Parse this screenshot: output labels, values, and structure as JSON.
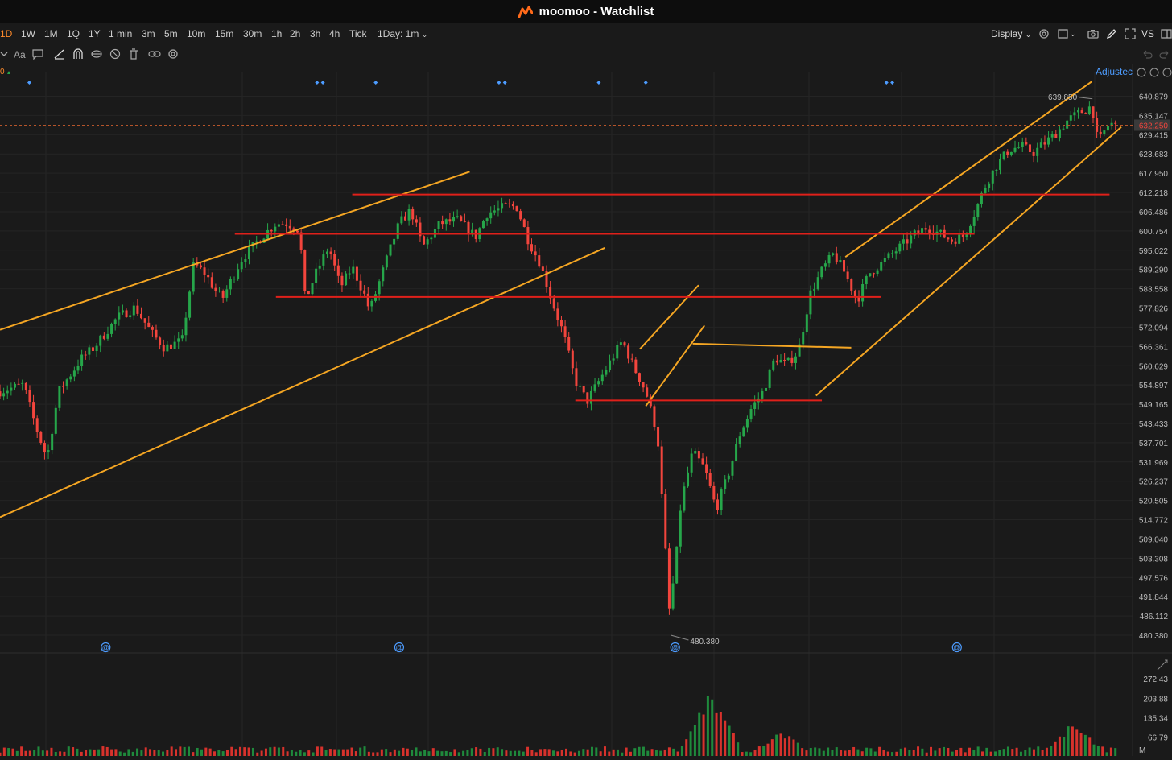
{
  "window": {
    "title": "moomoo - Watchlist"
  },
  "periods": [
    {
      "label": "1D",
      "active": true
    },
    {
      "label": "1W"
    },
    {
      "label": "1M"
    },
    {
      "label": "1Q"
    },
    {
      "label": "1Y"
    },
    {
      "label": "1 min"
    },
    {
      "label": "3m"
    },
    {
      "label": "5m"
    },
    {
      "label": "10m"
    },
    {
      "label": "15m"
    },
    {
      "label": "30m"
    },
    {
      "label": "1h"
    },
    {
      "label": "2h"
    },
    {
      "label": "3h"
    },
    {
      "label": "4h"
    },
    {
      "label": "Tick"
    }
  ],
  "period_dropdown": {
    "label": "1Day: 1m"
  },
  "controls": {
    "display_label": "Display",
    "vs_label": "VS",
    "adjusted_label": "Adjustec"
  },
  "tool_icons": [
    "chevron-down-icon",
    "font-icon",
    "comment-icon",
    "line-tool-icon",
    "magnet-icon",
    "eye-icon",
    "hide-icon",
    "trash-icon",
    "link-icon",
    "settings-icon"
  ],
  "colors": {
    "up": "#26a64a",
    "down": "#f2453d",
    "trendline": "#f5a623",
    "level": "#e0201a",
    "accent": "#ff8a2a",
    "background": "#1a1a1a"
  },
  "chart_data": {
    "type": "candlestick",
    "ylim": [
      477.5,
      646.0
    ],
    "yticks": [
      640.879,
      635.147,
      629.415,
      623.683,
      617.95,
      612.218,
      606.486,
      600.754,
      595.022,
      589.29,
      583.558,
      577.826,
      572.094,
      566.361,
      560.629,
      554.897,
      549.165,
      543.433,
      537.701,
      531.969,
      526.237,
      520.505,
      514.772,
      509.04,
      503.308,
      497.576,
      491.844,
      486.112,
      480.38
    ],
    "last_price": "632.250",
    "high_label": "639.850",
    "low_label": "480.380",
    "indicator_label": "0",
    "close_path": [
      [
        0,
        553
      ],
      [
        0.04,
        555
      ],
      [
        0.06,
        543
      ],
      [
        0.08,
        533
      ],
      [
        0.1,
        553
      ],
      [
        0.14,
        563
      ],
      [
        0.16,
        566
      ],
      [
        0.2,
        575
      ],
      [
        0.23,
        578
      ],
      [
        0.26,
        570
      ],
      [
        0.28,
        566
      ],
      [
        0.31,
        568
      ],
      [
        0.33,
        591
      ],
      [
        0.35,
        588
      ],
      [
        0.37,
        582
      ],
      [
        0.38,
        581
      ],
      [
        0.41,
        592
      ],
      [
        0.44,
        598
      ],
      [
        0.47,
        603
      ],
      [
        0.49,
        603
      ],
      [
        0.51,
        601
      ],
      [
        0.52,
        580
      ],
      [
        0.54,
        589
      ],
      [
        0.56,
        596
      ],
      [
        0.58,
        584
      ],
      [
        0.6,
        590
      ],
      [
        0.62,
        582
      ],
      [
        0.63,
        577
      ],
      [
        0.66,
        593
      ],
      [
        0.68,
        603
      ],
      [
        0.7,
        607
      ],
      [
        0.72,
        596
      ],
      [
        0.75,
        603
      ],
      [
        0.78,
        604
      ],
      [
        0.81,
        599
      ],
      [
        0.83,
        606
      ],
      [
        0.86,
        608
      ],
      [
        0.88,
        608
      ],
      [
        0.9,
        598
      ],
      [
        0.92,
        591
      ],
      [
        0.94,
        580
      ],
      [
        0.96,
        570
      ],
      [
        0.98,
        556
      ],
      [
        1.0,
        550
      ],
      [
        1.02,
        556
      ],
      [
        1.04,
        562
      ],
      [
        1.06,
        568
      ],
      [
        1.08,
        560
      ],
      [
        1.1,
        553
      ],
      [
        1.12,
        540
      ],
      [
        1.13,
        515
      ],
      [
        1.14,
        488
      ],
      [
        1.15,
        500
      ],
      [
        1.16,
        520
      ],
      [
        1.18,
        535
      ],
      [
        1.2,
        530
      ],
      [
        1.22,
        518
      ],
      [
        1.24,
        528
      ],
      [
        1.26,
        540
      ],
      [
        1.28,
        548
      ],
      [
        1.3,
        553
      ],
      [
        1.32,
        563
      ],
      [
        1.34,
        561
      ],
      [
        1.36,
        565
      ],
      [
        1.38,
        582
      ],
      [
        1.4,
        589
      ],
      [
        1.42,
        594
      ],
      [
        1.44,
        588
      ],
      [
        1.46,
        580
      ],
      [
        1.48,
        588
      ],
      [
        1.5,
        591
      ],
      [
        1.52,
        594
      ],
      [
        1.54,
        597
      ],
      [
        1.56,
        600
      ],
      [
        1.58,
        602
      ],
      [
        1.6,
        600
      ],
      [
        1.62,
        598
      ],
      [
        1.64,
        599
      ],
      [
        1.66,
        606
      ],
      [
        1.68,
        615
      ],
      [
        1.7,
        621
      ],
      [
        1.72,
        625
      ],
      [
        1.74,
        626
      ],
      [
        1.76,
        624
      ],
      [
        1.78,
        627
      ],
      [
        1.8,
        630
      ],
      [
        1.82,
        634
      ],
      [
        1.84,
        636
      ],
      [
        1.86,
        638
      ],
      [
        1.87,
        627
      ],
      [
        1.89,
        633
      ],
      [
        1.9,
        632
      ]
    ],
    "volume": {
      "yticks": [
        272.43,
        203.88,
        135.34,
        66.79
      ],
      "ylim": [
        0,
        290
      ],
      "unit": "M",
      "spikes": [
        [
          1.21,
          247
        ],
        [
          1.33,
          95
        ],
        [
          1.83,
          128
        ]
      ]
    },
    "drawings": {
      "lines": [
        {
          "kind": "trend",
          "from": [
            0,
            571.3
          ],
          "to": [
            0.8,
            618.4
          ]
        },
        {
          "kind": "trend",
          "from": [
            0,
            515.5
          ],
          "to": [
            1.03,
            595.7
          ]
        },
        {
          "kind": "trend",
          "from": [
            1.09,
            565.6
          ],
          "to": [
            1.19,
            584.6
          ]
        },
        {
          "kind": "trend",
          "from": [
            1.1,
            548.6
          ],
          "to": [
            1.2,
            572.6
          ]
        },
        {
          "kind": "trend",
          "from": [
            1.18,
            567.2
          ],
          "to": [
            1.45,
            566.0
          ]
        },
        {
          "kind": "trend",
          "from": [
            1.44,
            593.0
          ],
          "to": [
            1.86,
            645.3
          ]
        },
        {
          "kind": "trend",
          "from": [
            1.39,
            551.7
          ],
          "to": [
            1.91,
            631.7
          ]
        },
        {
          "kind": "level",
          "from": [
            0.6,
            611.6
          ],
          "to": [
            1.89,
            611.6
          ]
        },
        {
          "kind": "level",
          "from": [
            0.4,
            599.9
          ],
          "to": [
            1.66,
            599.9
          ]
        },
        {
          "kind": "level",
          "from": [
            0.47,
            581.1
          ],
          "to": [
            1.5,
            581.1
          ]
        },
        {
          "kind": "level",
          "from": [
            0.98,
            550.3
          ],
          "to": [
            1.4,
            550.3
          ]
        }
      ]
    },
    "event_markers": {
      "diamonds": [
        0.05,
        0.54,
        0.55,
        0.64,
        0.85,
        0.86,
        1.02,
        1.1,
        1.51,
        1.52
      ],
      "earnings": [
        0.18,
        0.68,
        1.15,
        1.63
      ]
    }
  }
}
